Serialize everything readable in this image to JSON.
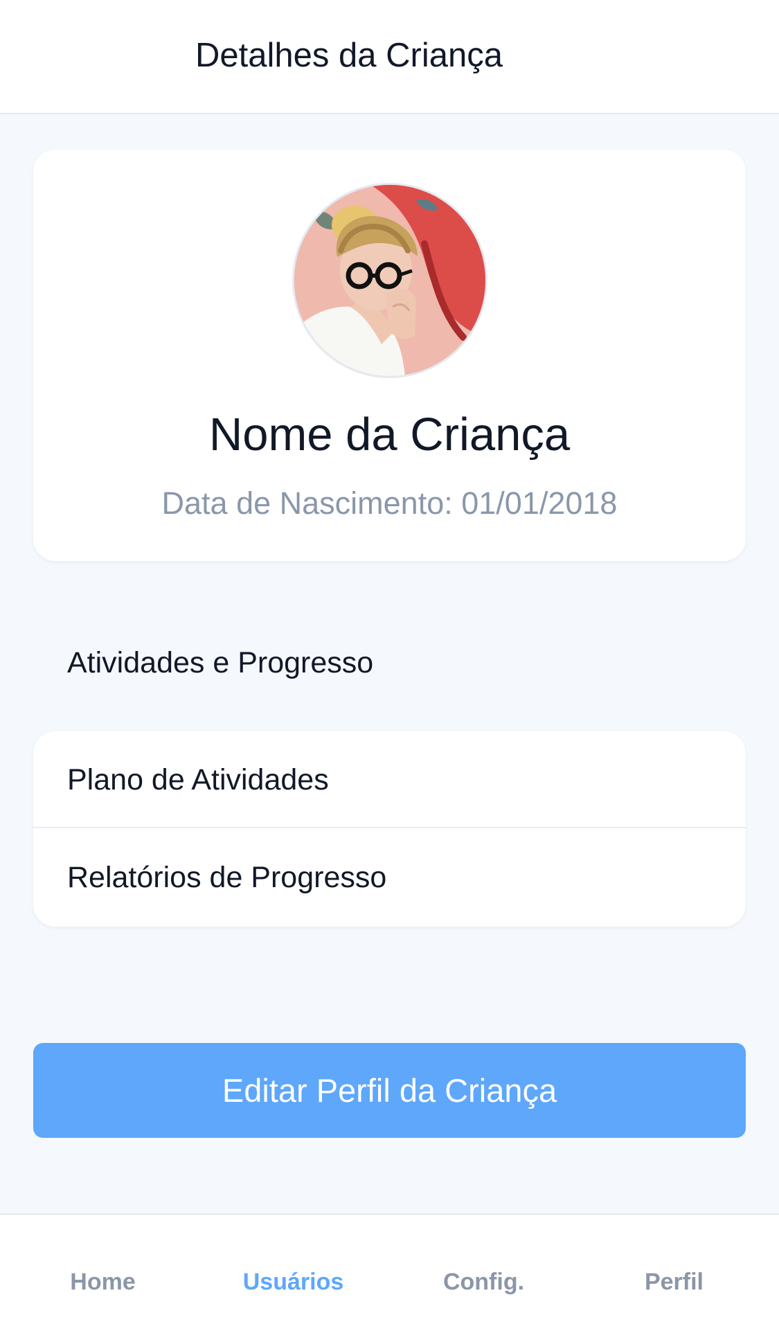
{
  "header": {
    "title": "Detalhes da Criança"
  },
  "profile": {
    "avatar_icon": "child-photo",
    "name": "Nome da Criança",
    "birthdate": "Data de Nascimento: 01/01/2018"
  },
  "activities": {
    "section_title": "Atividades e Progresso",
    "items": [
      {
        "label": "Plano de Atividades"
      },
      {
        "label": "Relatórios de Progresso"
      }
    ]
  },
  "actions": {
    "edit_label": "Editar Perfil da Criança"
  },
  "bottom_nav": {
    "active": "Usuários",
    "items": [
      {
        "label": "Home"
      },
      {
        "label": "Usuários"
      },
      {
        "label": "Config."
      },
      {
        "label": "Perfil"
      }
    ]
  },
  "colors": {
    "accent": "#5ea7fb",
    "background": "#f5f8fc",
    "text_primary": "#111827",
    "text_muted": "#8a97aa"
  }
}
